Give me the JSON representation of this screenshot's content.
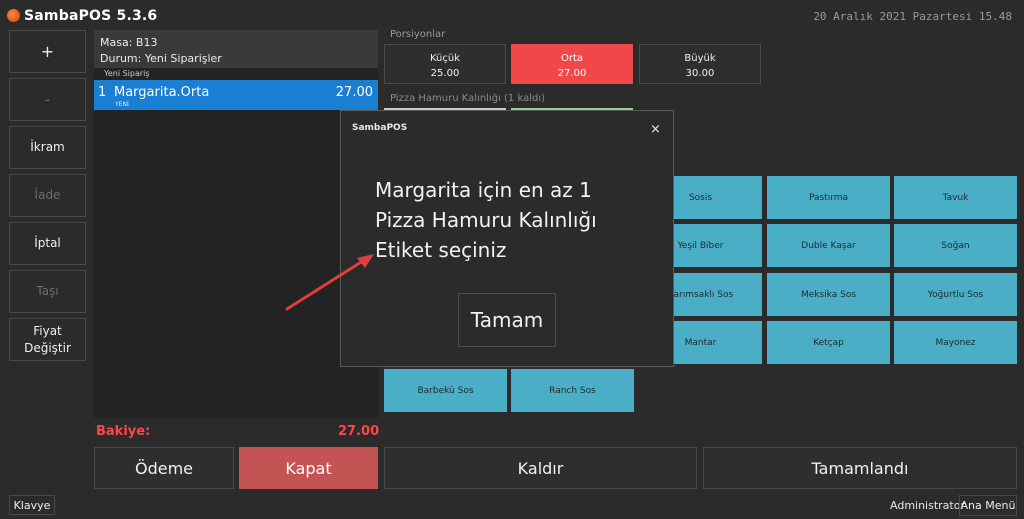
{
  "app": {
    "title": "SambaPOS 5.3.6",
    "date": "20 Aralık 2021 Pazartesi 15.48"
  },
  "left_buttons": {
    "plus": "+",
    "minus": "-",
    "gift": "İkram",
    "refund": "İade",
    "cancel": "İptal",
    "move": "Taşı",
    "change_price_line1": "Fiyat",
    "change_price_line2": "Değiştir"
  },
  "ticket": {
    "table": "Masa: B13",
    "status": "Durum: Yeni Siparişler",
    "group_label": "Yeni Sipariş",
    "order": {
      "qty": "1",
      "name": "Margarita.Orta",
      "total": "27.00",
      "state": "YENİ"
    },
    "balance_label": "Bakiye:",
    "balance_value": "27.00"
  },
  "portions": {
    "title": "Porsiyonlar",
    "items": [
      {
        "name": "Küçük",
        "price": "25.00",
        "selected": false
      },
      {
        "name": "Orta",
        "price": "27.00",
        "selected": true
      },
      {
        "name": "Büyük",
        "price": "30.00",
        "selected": false
      }
    ]
  },
  "thickness": {
    "title": "Pizza Hamuru Kalınlığı (1 kaldı)"
  },
  "sauces": {
    "sosis": "Sosis",
    "pastirma": "Pastırma",
    "tavuk": "Tavuk",
    "yesil_biber": "Yeşil Biber",
    "duble_kasar": "Duble Kaşar",
    "sogan": "Soğan",
    "sarimsakli_sos": "Sarımsaklı Sos",
    "meksika_sos": "Meksika Sos",
    "yogurtlu_sos": "Yoğurtlu Sos",
    "mantar": "Mantar",
    "ketcap": "Ketçap",
    "mayonez": "Mayonez",
    "barbeku_sos": "Barbekü Sos",
    "ranch_sos": "Ranch Sos"
  },
  "bottom": {
    "payment": "Ödeme",
    "close": "Kapat",
    "remove": "Kaldır",
    "done": "Tamamlandı",
    "keyboard": "Klavye",
    "user": "Administrator",
    "main_menu": "Ana Menü"
  },
  "dialog": {
    "title": "SambaPOS",
    "close": "×",
    "message_line1": "Margarita için en az 1",
    "message_line2": "Pizza Hamuru Kalınlığı",
    "message_line3": "Etiket seçiniz",
    "ok": "Tamam"
  },
  "colors": {
    "background": "#2b2b2b",
    "selected_order": "#1a7fd2",
    "selected_portion": "#f04848",
    "sauce_button": "#4aaec6",
    "close_button": "#c45453",
    "balance": "#ff4545",
    "annotation_arrow": "#e23c3c"
  }
}
